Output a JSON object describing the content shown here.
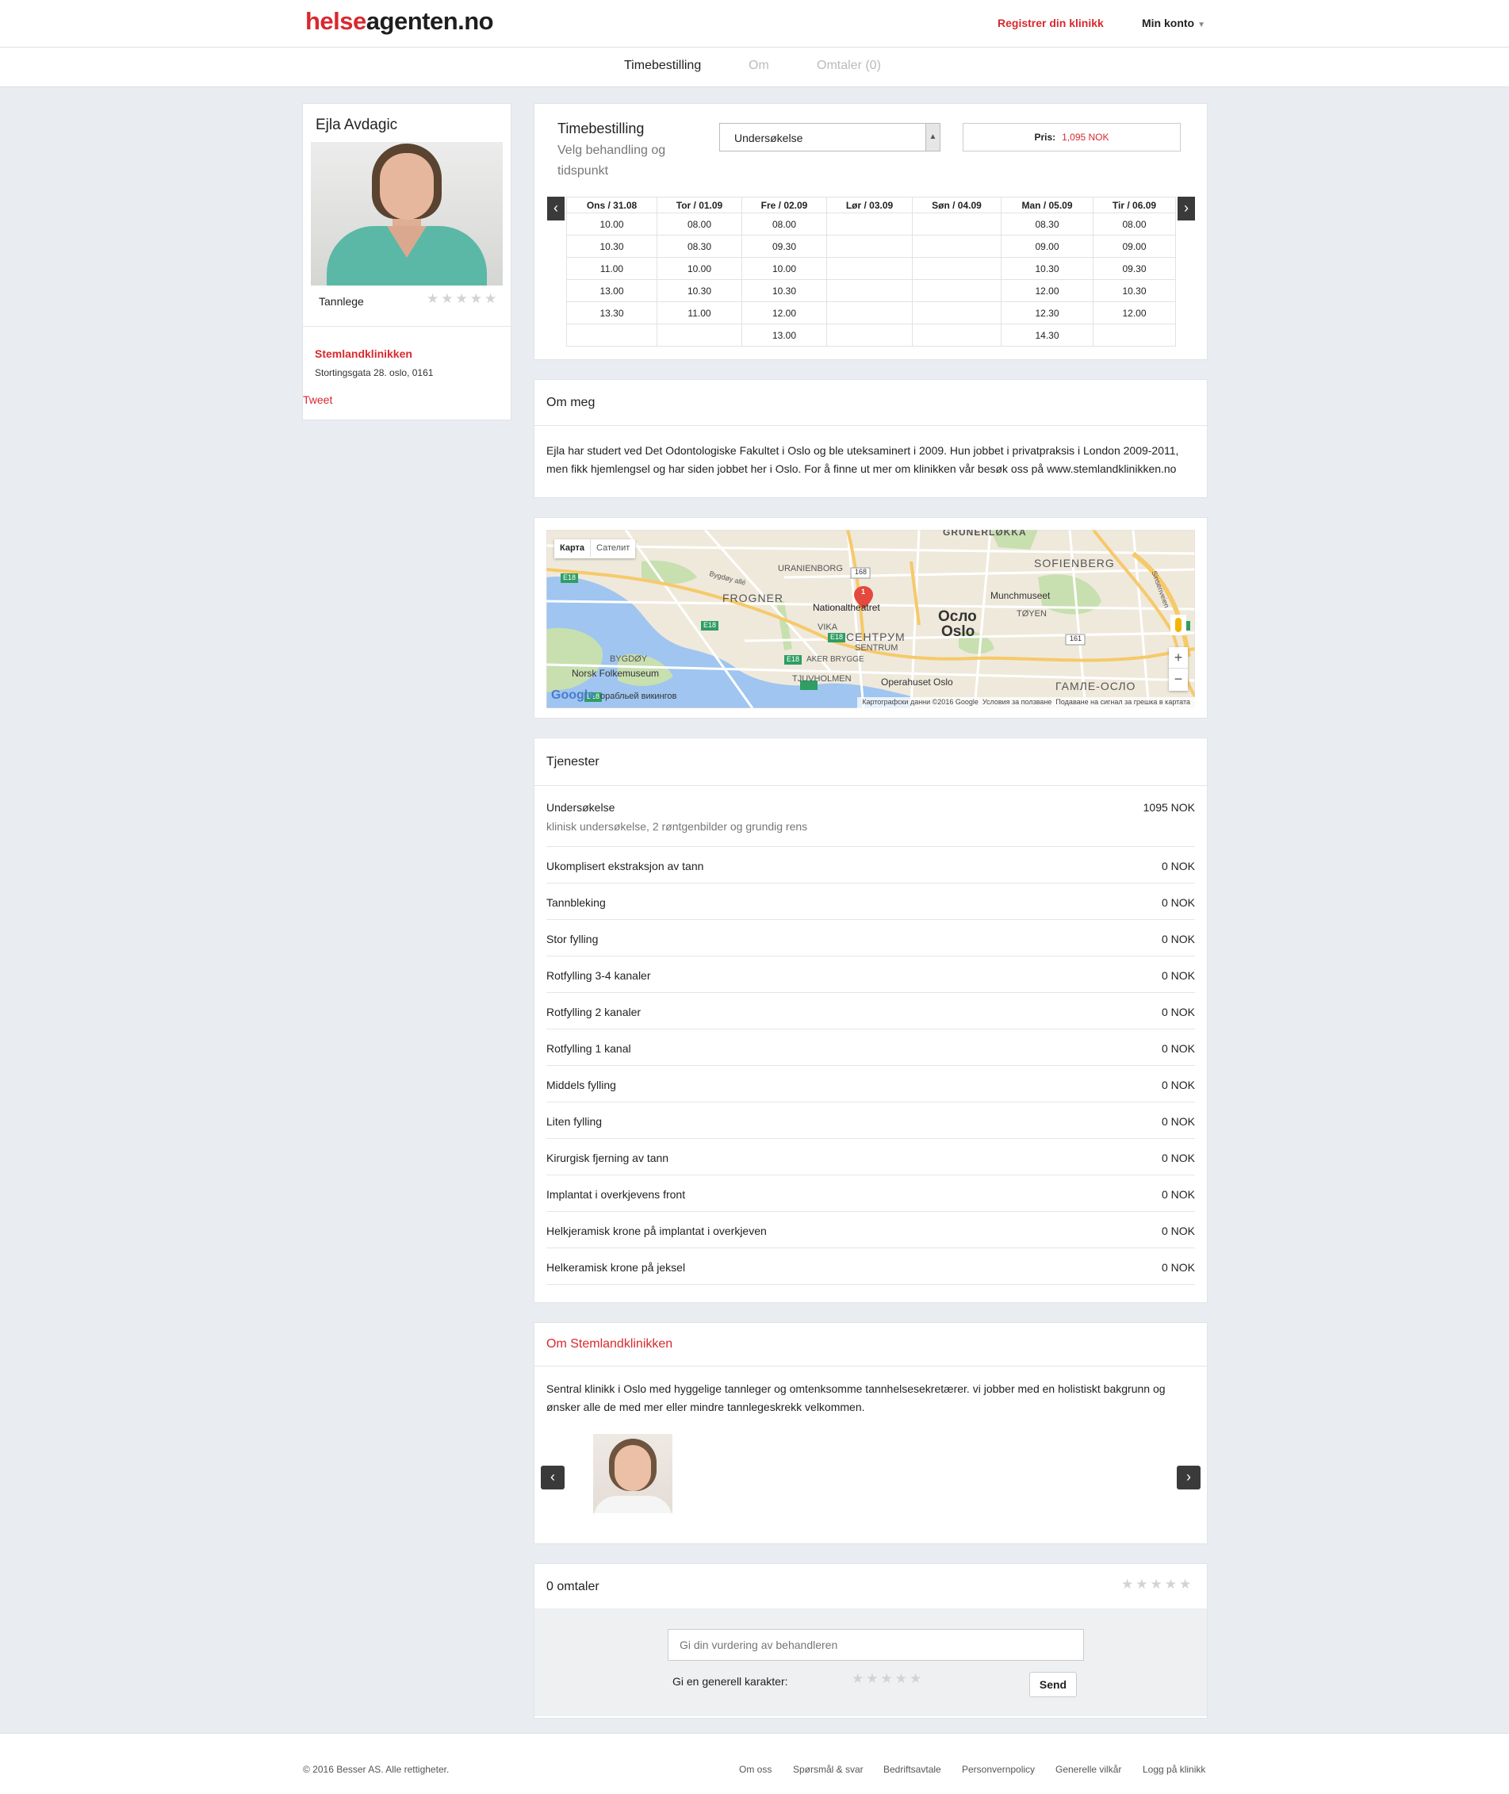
{
  "header": {
    "logo_part1": "helse",
    "logo_part2": "agenten.no",
    "register_link": "Registrer din klinikk",
    "account_menu": "Min konto"
  },
  "nav": {
    "tabs": [
      {
        "label": "Timebestilling",
        "active": true
      },
      {
        "label": "Om",
        "active": false
      },
      {
        "label": "Omtaler (0)",
        "active": false
      }
    ]
  },
  "profile": {
    "name": "Ejla Avdagic",
    "profession": "Tannlege",
    "rating_stars": "★★★★★",
    "clinic_name": "Stemlandklinikken",
    "clinic_address": "Stortingsgata 28. oslo, 0161",
    "tweet": "Tweet"
  },
  "booking": {
    "title": "Timebestilling",
    "subtitle": "Velg behandling og tidspunkt",
    "selected_treatment": "Undersøkelse",
    "price_label": "Pris:",
    "price_value": "1,095 NOK",
    "prev_icon": "chevron-left-icon",
    "next_icon": "chevron-right-icon",
    "days": [
      "Ons / 31.08",
      "Tor / 01.09",
      "Fre / 02.09",
      "Lør / 03.09",
      "Søn / 04.09",
      "Man / 05.09",
      "Tir / 06.09"
    ],
    "rows": [
      [
        "10.00",
        "08.00",
        "08.00",
        "",
        "",
        "08.30",
        "08.00"
      ],
      [
        "10.30",
        "08.30",
        "09.30",
        "",
        "",
        "09.00",
        "09.00"
      ],
      [
        "11.00",
        "10.00",
        "10.00",
        "",
        "",
        "10.30",
        "09.30"
      ],
      [
        "13.00",
        "10.30",
        "10.30",
        "",
        "",
        "12.00",
        "10.30"
      ],
      [
        "13.30",
        "11.00",
        "12.00",
        "",
        "",
        "12.30",
        "12.00"
      ],
      [
        "",
        "",
        "13.00",
        "",
        "",
        "14.30",
        ""
      ]
    ]
  },
  "about": {
    "title": "Om meg",
    "text": "Ejla har studert ved Det Odontologiske Fakultet i Oslo og ble uteksaminert i 2009. Hun jobbet i privatpraksis i London 2009-2011, men fikk hjemlengsel og har siden jobbet her i Oslo. For å finne ut mer om klinikken vår besøk oss på www.stemlandklinikken.no"
  },
  "map": {
    "btn_map": "Карта",
    "btn_sat": "Сателит",
    "labels": [
      "GRÜNERLØKKA",
      "URANIENBORG",
      "SOFIENBERG",
      "FROGNER",
      "Nationaltheatret",
      "Munchmuseet",
      "TØYEN",
      "Осло",
      "Oslo",
      "VIKA",
      "СЕНТРУМ",
      "SENTRUM",
      "BYGDØY",
      "Norsk Folkemuseum",
      "AKER BRYGGE",
      "TJUVHOLMEN",
      "Operahuset Oslo",
      "ГАМЛЕ-ОСЛО",
      "Bygdøy allé",
      "Sinsenveien"
    ],
    "road_numbers": [
      "168",
      "161",
      "E18",
      "E18",
      "E18",
      "E18",
      "E18"
    ],
    "marker": "1",
    "zoom_in": "+",
    "zoom_out": "−",
    "attribution": "Картографски данни ©2016 Google",
    "terms": "Условия за ползване",
    "report": "Подаване на сигнал за грешка в картата",
    "google": "Google",
    "extra": "орабльей викингов"
  },
  "services": {
    "title": "Tjenester",
    "items": [
      {
        "name": "Undersøkelse",
        "desc": "klinisk undersøkelse, 2 røntgenbilder og grundig rens",
        "price": "1095 NOK"
      },
      {
        "name": "Ukomplisert ekstraksjon av tann",
        "price": "0 NOK"
      },
      {
        "name": "Tannbleking",
        "price": "0 NOK"
      },
      {
        "name": "Stor fylling",
        "price": "0 NOK"
      },
      {
        "name": "Rotfylling 3-4 kanaler",
        "price": "0 NOK"
      },
      {
        "name": "Rotfylling 2 kanaler",
        "price": "0 NOK"
      },
      {
        "name": "Rotfylling 1 kanal",
        "price": "0 NOK"
      },
      {
        "name": "Middels fylling",
        "price": "0 NOK"
      },
      {
        "name": "Liten fylling",
        "price": "0 NOK"
      },
      {
        "name": "Kirurgisk fjerning av tann",
        "price": "0 NOK"
      },
      {
        "name": "Implantat i overkjevens front",
        "price": "0 NOK"
      },
      {
        "name": "Helkjeramisk krone på implantat i overkjeven",
        "price": "0 NOK"
      },
      {
        "name": "Helkeramisk krone på jeksel",
        "price": "0 NOK"
      }
    ]
  },
  "clinic_about": {
    "title": "Om Stemlandklinikken",
    "text": "Sentral klinikk i Oslo med hyggelige tannleger og omtenksomme tannhelsesekretærer. vi jobber med en holistiskt bakgrunn og ønsker alle de med mer eller mindre tannlegeskrekk velkommen.",
    "prev": "‹",
    "next": "›"
  },
  "reviews": {
    "title": "0 omtaler",
    "stars": "★★★★★",
    "placeholder": "Gi din vurdering av behandleren",
    "rating_label": "Gi en generell karakter:",
    "send": "Send"
  },
  "footer": {
    "copyright": "© 2016 Besser AS. Alle rettigheter.",
    "links": [
      "Om oss",
      "Spørsmål & svar",
      "Bedriftsavtale",
      "Personvernpolicy",
      "Generelle vilkår",
      "Logg på klinikk"
    ]
  },
  "colors": {
    "accent": "#d9282f",
    "background": "#e9edf1"
  }
}
